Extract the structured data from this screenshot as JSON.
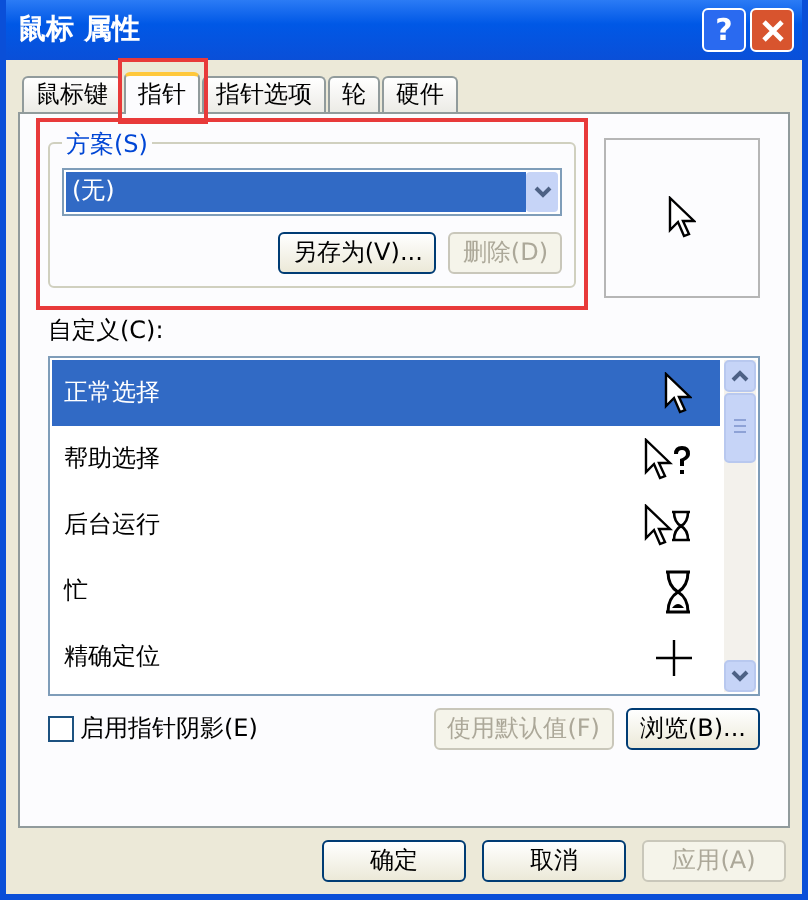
{
  "window": {
    "title": "鼠标 属性",
    "help_button": "?"
  },
  "tabs": [
    {
      "label": "鼠标键",
      "selected": false,
      "highlighted": false
    },
    {
      "label": "指针",
      "selected": true,
      "highlighted": true
    },
    {
      "label": "指针选项",
      "selected": false,
      "highlighted": false
    },
    {
      "label": "轮",
      "selected": false,
      "highlighted": false
    },
    {
      "label": "硬件",
      "selected": false,
      "highlighted": false
    }
  ],
  "scheme": {
    "label": "方案(S)",
    "value": "(无)",
    "highlighted": true,
    "buttons": [
      {
        "label": "另存为(V)...",
        "disabled": false
      },
      {
        "label": "删除(D)",
        "disabled": true
      }
    ]
  },
  "customize": {
    "label": "自定义(C):",
    "items": [
      {
        "label": "正常选择",
        "kind": "arrow",
        "selected": true
      },
      {
        "label": "帮助选择",
        "kind": "help",
        "selected": false
      },
      {
        "label": "后台运行",
        "kind": "working",
        "selected": false
      },
      {
        "label": "忙",
        "kind": "busy",
        "selected": false
      },
      {
        "label": "精确定位",
        "kind": "crosshair",
        "selected": false
      }
    ]
  },
  "shadow": {
    "label": "启用指针阴影(E)",
    "checked": false
  },
  "list_buttons": [
    {
      "label": "使用默认值(F)",
      "disabled": true
    },
    {
      "label": "浏览(B)...",
      "disabled": false
    }
  ],
  "dialog_buttons": [
    {
      "label": "确定",
      "disabled": false
    },
    {
      "label": "取消",
      "disabled": false
    },
    {
      "label": "应用(A)",
      "disabled": true
    }
  ]
}
